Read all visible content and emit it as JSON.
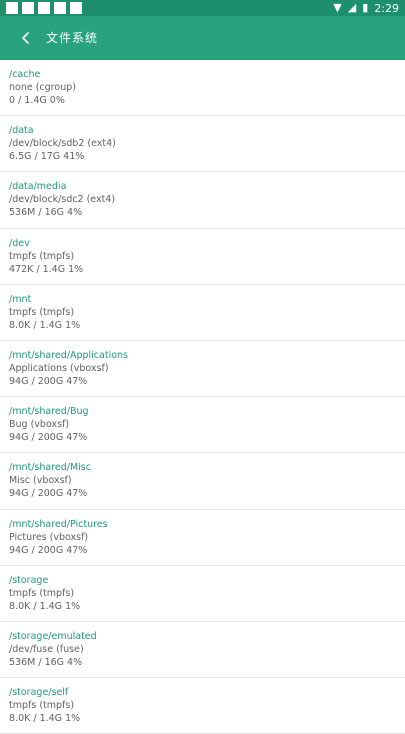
{
  "status_bar": {
    "time": "2:29",
    "battery_glyph": "▮",
    "wifi_glyph": "▼",
    "signal_glyph": "◢",
    "icons": [
      "notification-icon",
      "notification-icon",
      "notification-icon",
      "image-icon",
      "a-icon"
    ]
  },
  "toolbar": {
    "title": "文件系统",
    "back_icon": "chevron-left-icon"
  },
  "colors": {
    "status_bar": "#1e8f6c",
    "toolbar": "#28a37e",
    "accent_text": "#1f9a77",
    "secondary_text": "#616161"
  },
  "filesystems": [
    {
      "mount": "/cache",
      "fs": "none (cgroup)",
      "usage": "0 / 1.4G 0%"
    },
    {
      "mount": "/data",
      "fs": "/dev/block/sdb2 (ext4)",
      "usage": "6.5G / 17G 41%"
    },
    {
      "mount": "/data/media",
      "fs": "/dev/block/sdc2 (ext4)",
      "usage": "536M / 16G 4%"
    },
    {
      "mount": "/dev",
      "fs": "tmpfs (tmpfs)",
      "usage": "472K / 1.4G 1%"
    },
    {
      "mount": "/mnt",
      "fs": "tmpfs (tmpfs)",
      "usage": "8.0K / 1.4G 1%"
    },
    {
      "mount": "/mnt/shared/Applications",
      "fs": "Applications (vboxsf)",
      "usage": "94G / 200G 47%"
    },
    {
      "mount": "/mnt/shared/Bug",
      "fs": "Bug (vboxsf)",
      "usage": "94G / 200G 47%"
    },
    {
      "mount": "/mnt/shared/Misc",
      "fs": "Misc (vboxsf)",
      "usage": "94G / 200G 47%"
    },
    {
      "mount": "/mnt/shared/Pictures",
      "fs": "Pictures (vboxsf)",
      "usage": "94G / 200G 47%"
    },
    {
      "mount": "/storage",
      "fs": "tmpfs (tmpfs)",
      "usage": "8.0K / 1.4G 1%"
    },
    {
      "mount": "/storage/emulated",
      "fs": "/dev/fuse (fuse)",
      "usage": "536M / 16G 4%"
    },
    {
      "mount": "/storage/self",
      "fs": "tmpfs (tmpfs)",
      "usage": "8.0K / 1.4G 1%"
    }
  ]
}
